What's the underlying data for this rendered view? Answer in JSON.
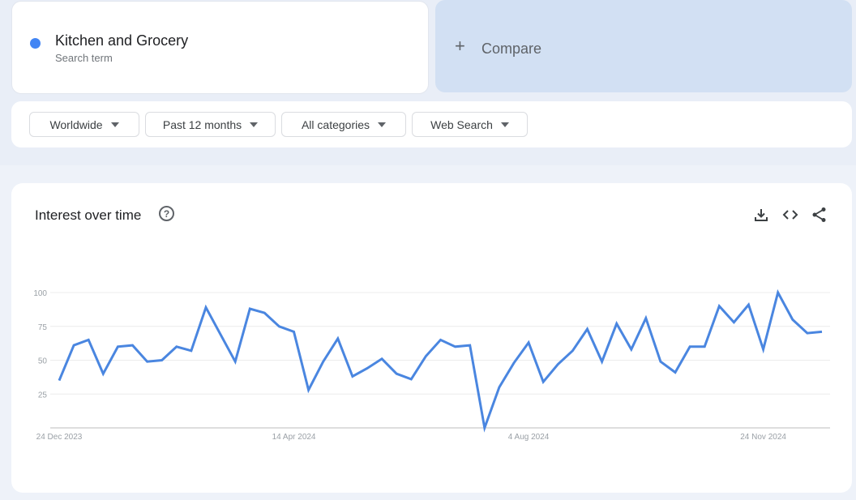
{
  "search_term": {
    "name": "Kitchen and Grocery",
    "subtitle": "Search term",
    "color": "#4285f4"
  },
  "compare": {
    "icon": "plus-icon",
    "label": "Compare"
  },
  "filters": [
    {
      "label": "Worldwide"
    },
    {
      "label": "Past 12 months"
    },
    {
      "label": "All categories"
    },
    {
      "label": "Web Search"
    }
  ],
  "panel": {
    "title": "Interest over time",
    "help_icon": "?",
    "actions": [
      "download-icon",
      "embed-code-icon",
      "share-icon"
    ]
  },
  "chart_data": {
    "type": "line",
    "title": "Interest over time",
    "xlabel": "",
    "ylabel": "",
    "ylim": [
      0,
      100
    ],
    "yticks": [
      25,
      50,
      75,
      100
    ],
    "xtick_labels": [
      {
        "label": "24 Dec 2023",
        "index": 0
      },
      {
        "label": "14 Apr 2024",
        "index": 16
      },
      {
        "label": "4 Aug 2024",
        "index": 32
      },
      {
        "label": "24 Nov 2024",
        "index": 48
      }
    ],
    "grid": true,
    "series": [
      {
        "name": "Kitchen and Grocery",
        "color": "#4a86e0",
        "values": [
          35,
          61,
          65,
          40,
          60,
          61,
          49,
          50,
          60,
          57,
          89,
          69,
          49,
          88,
          85,
          75,
          71,
          28,
          49,
          66,
          38,
          44,
          51,
          40,
          36,
          53,
          65,
          60,
          61,
          0,
          30,
          48,
          63,
          34,
          47,
          57,
          73,
          49,
          77,
          58,
          81,
          49,
          41,
          60,
          60,
          90,
          78,
          91,
          58,
          100,
          80,
          70,
          71
        ]
      }
    ]
  }
}
